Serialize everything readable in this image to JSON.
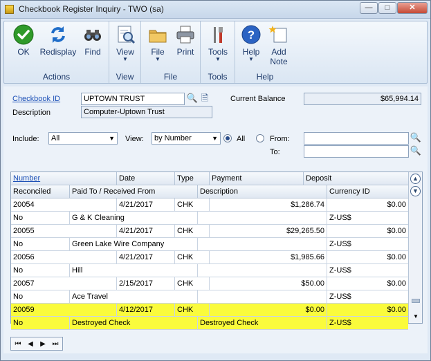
{
  "window": {
    "title": "Checkbook Register Inquiry  -  TWO (sa)",
    "controls": [
      "—",
      "□",
      "✕"
    ]
  },
  "ribbon": {
    "groups": [
      {
        "label": "Actions",
        "buttons": [
          {
            "label": "OK",
            "icon": "checkmark-icon"
          },
          {
            "label": "Redisplay",
            "icon": "redisplay-icon"
          },
          {
            "label": "Find",
            "icon": "binoculars-icon"
          }
        ]
      },
      {
        "label": "View",
        "buttons": [
          {
            "label": "View",
            "icon": "view-icon"
          }
        ]
      },
      {
        "label": "File",
        "buttons": [
          {
            "label": "File",
            "icon": "folder-icon"
          },
          {
            "label": "Print",
            "icon": "printer-icon"
          }
        ]
      },
      {
        "label": "Tools",
        "buttons": [
          {
            "label": "Tools",
            "icon": "tools-icon"
          }
        ]
      },
      {
        "label": "Help",
        "buttons": [
          {
            "label": "Help",
            "icon": "help-icon"
          },
          {
            "label": "Add Note",
            "icon": "add-note-icon"
          }
        ]
      }
    ]
  },
  "form": {
    "checkbook_id_label": "Checkbook ID",
    "checkbook_id_value": "UPTOWN TRUST",
    "description_label": "Description",
    "description_value": "Computer-Uptown Trust",
    "current_balance_label": "Current Balance",
    "current_balance_value": "$65,994.14",
    "include_label": "Include:",
    "include_value": "All",
    "view_label": "View:",
    "view_value": "by Number",
    "radio_all_label": "All",
    "radio_from_label": "From:",
    "to_label": "To:"
  },
  "grid": {
    "header1": [
      "Number",
      "Date",
      "Type",
      "Payment",
      "Deposit"
    ],
    "header2": [
      "Reconciled",
      "Paid To / Received From",
      "Description",
      "Currency ID"
    ],
    "records": [
      {
        "number": "20054",
        "date": "4/21/2017",
        "type": "CHK",
        "payment": "$1,286.74",
        "deposit": "$0.00",
        "reconciled": "No",
        "paid_to": "G & K Cleaning",
        "description": "",
        "currency": "Z-US$",
        "highlight": false
      },
      {
        "number": "20055",
        "date": "4/21/2017",
        "type": "CHK",
        "payment": "$29,265.50",
        "deposit": "$0.00",
        "reconciled": "No",
        "paid_to": "Green Lake Wire Company",
        "description": "",
        "currency": "Z-US$",
        "highlight": false
      },
      {
        "number": "20056",
        "date": "4/21/2017",
        "type": "CHK",
        "payment": "$1,985.66",
        "deposit": "$0.00",
        "reconciled": "No",
        "paid_to": "Hill",
        "description": "",
        "currency": "Z-US$",
        "highlight": false
      },
      {
        "number": "20057",
        "date": "2/15/2017",
        "type": "CHK",
        "payment": "$50.00",
        "deposit": "$0.00",
        "reconciled": "No",
        "paid_to": "Ace Travel",
        "description": "",
        "currency": "Z-US$",
        "highlight": false
      },
      {
        "number": "20059",
        "date": "4/12/2017",
        "type": "CHK",
        "payment": "$0.00",
        "deposit": "$0.00",
        "reconciled": "No",
        "paid_to": "Destroyed Check",
        "description": "Destroyed Check",
        "currency": "Z-US$",
        "highlight": true
      }
    ]
  },
  "nav": {
    "first": "⏮",
    "prev": "◀",
    "next": "▶",
    "last": "⏭"
  },
  "colors": {
    "highlight": "#fafb3c",
    "link": "#1b4fb6"
  }
}
